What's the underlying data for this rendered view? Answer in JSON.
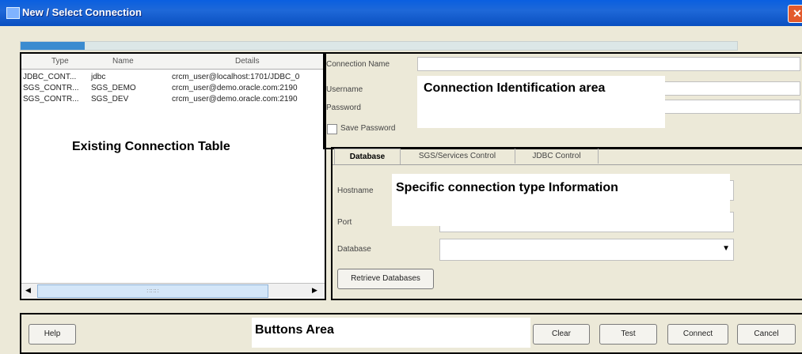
{
  "window": {
    "title": "New / Select Connection",
    "close_glyph": "✕"
  },
  "progress": {
    "percent": 9
  },
  "existing_table": {
    "headers": [
      "Type",
      "Name",
      "Details"
    ],
    "rows": [
      {
        "type": "JDBC_CONT...",
        "name": "jdbc",
        "details": "crcm_user@localhost:1701/JDBC_0"
      },
      {
        "type": "SGS_CONTR...",
        "name": "SGS_DEMO",
        "details": "crcm_user@demo.oracle.com:2190"
      },
      {
        "type": "SGS_CONTR...",
        "name": "SGS_DEV",
        "details": "crcm_user@demo.oracle.com:2190"
      }
    ],
    "scroll_left": "◀",
    "scroll_right": "▶",
    "scroll_grip": "∷∷∷"
  },
  "annotations": {
    "existing_table": "Existing Connection Table",
    "identification": "Connection Identification area",
    "specific": "Specific connection type Information",
    "buttons": "Buttons Area"
  },
  "identification": {
    "connection_name_label": "Connection Name",
    "username_label": "Username",
    "password_label": "Password",
    "save_password_label": "Save Password"
  },
  "tabs": [
    "Database",
    "SGS/Services Control",
    "JDBC Control"
  ],
  "specific": {
    "hostname_label": "Hostname",
    "port_label": "Port",
    "database_label": "Database",
    "dropdown_arrow": "▼",
    "retrieve_button": "Retrieve Databases"
  },
  "buttons": {
    "help": "Help",
    "clear": "Clear",
    "test": "Test",
    "connect": "Connect",
    "cancel": "Cancel"
  }
}
